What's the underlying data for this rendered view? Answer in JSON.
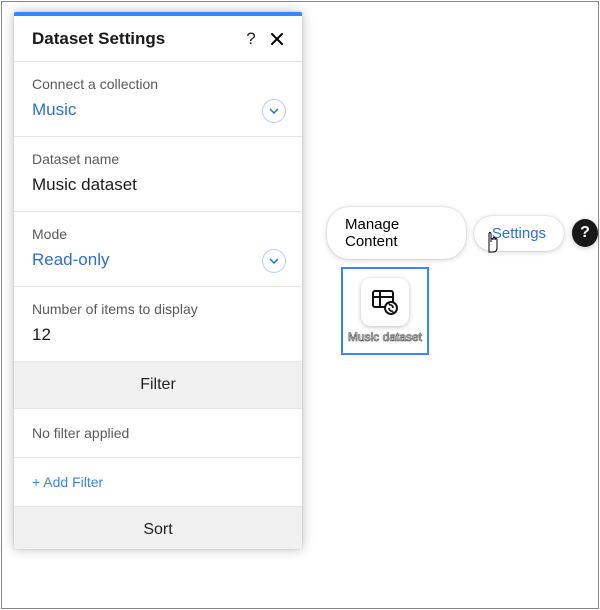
{
  "panel": {
    "title": "Dataset Settings",
    "sections": {
      "collection": {
        "label": "Connect a collection",
        "value": "Music"
      },
      "name": {
        "label": "Dataset name",
        "value": "Music dataset"
      },
      "mode": {
        "label": "Mode",
        "value": "Read-only"
      },
      "count": {
        "label": "Number of items to display",
        "value": "12"
      }
    },
    "filter": {
      "header": "Filter",
      "status": "No filter applied",
      "add": "+ Add Filter"
    },
    "sort": {
      "header": "Sort"
    }
  },
  "toolbar": {
    "manage": "Manage Content",
    "settings": "Settings",
    "help": "?"
  },
  "tile": {
    "label": "Music dataset"
  }
}
